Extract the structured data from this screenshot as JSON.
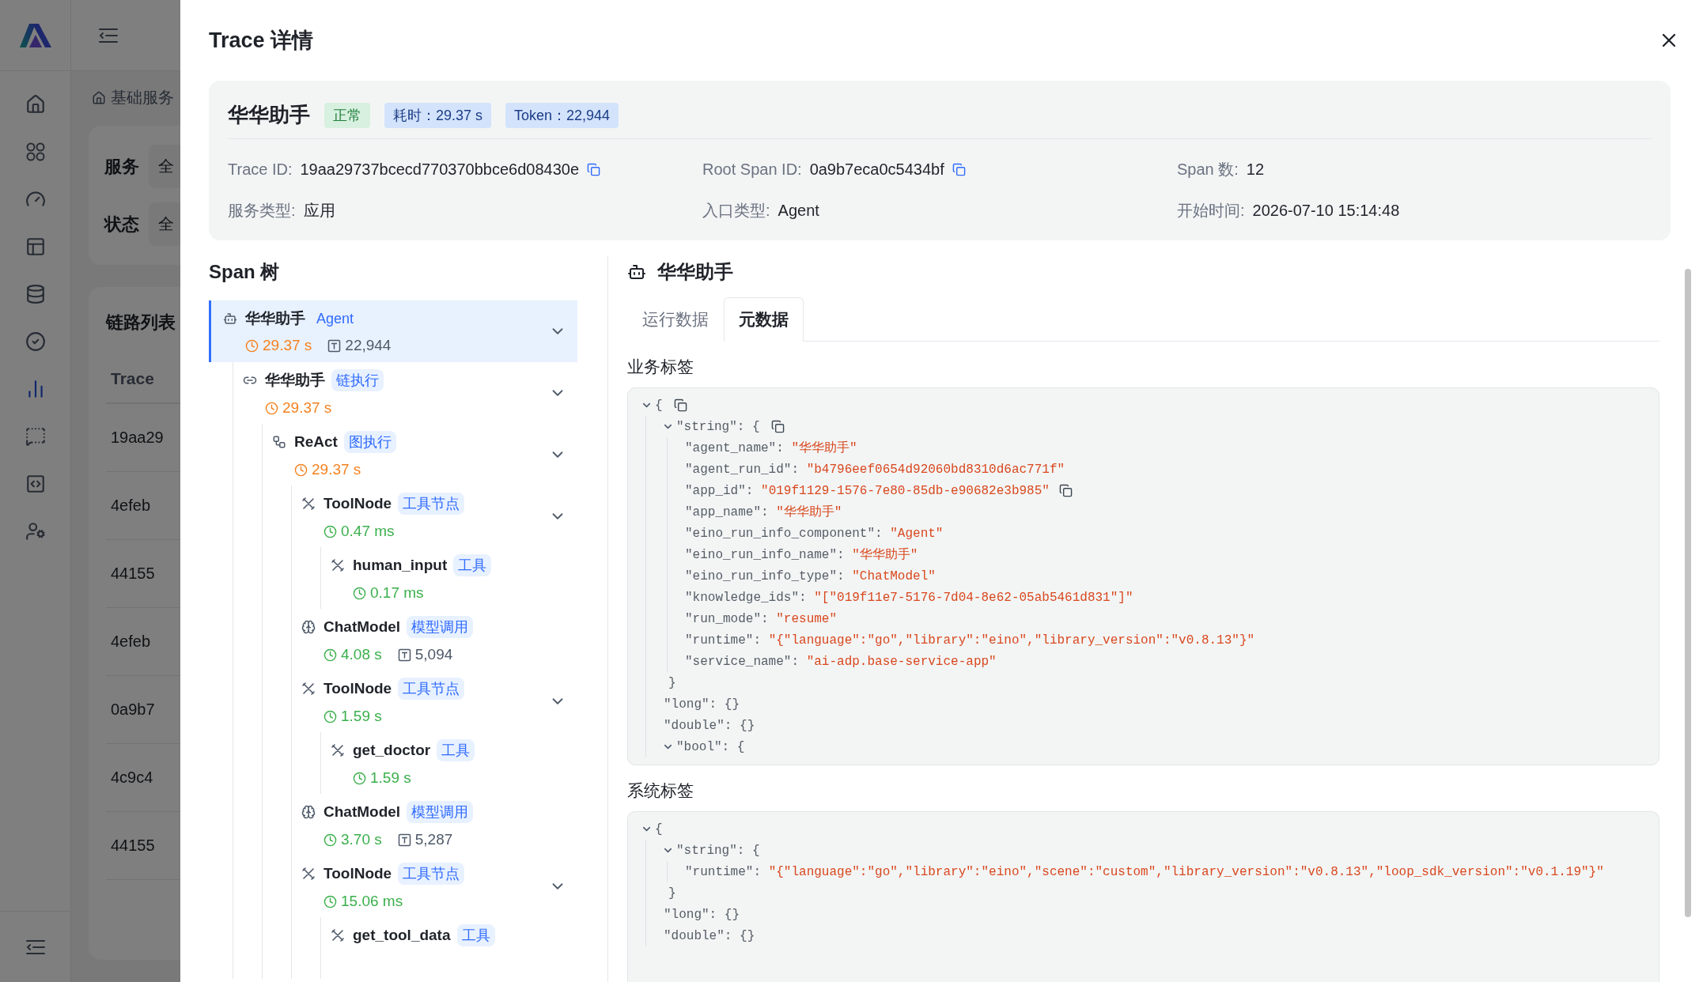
{
  "background": {
    "breadcrumb": "基础服务",
    "filters": [
      {
        "label": "服务",
        "value": "全"
      },
      {
        "label": "状态",
        "value": "全"
      }
    ],
    "list_title": "链路列表",
    "column_header": "Trace",
    "rows": [
      "19aa29",
      "4efeb",
      "44155",
      "4efeb",
      "0a9b7",
      "4c9c4",
      "44155"
    ],
    "nav_items": [
      {
        "selected": false
      },
      {
        "selected": false
      },
      {
        "selected": false
      },
      {
        "selected": false
      },
      {
        "selected": false
      },
      {
        "selected": false
      },
      {
        "selected": true
      },
      {
        "selected": false
      },
      {
        "selected": false
      },
      {
        "selected": false
      }
    ]
  },
  "drawer": {
    "title": "Trace 详情",
    "summary": {
      "name": "华华助手",
      "tags": [
        {
          "text": "正常",
          "kind": "success"
        },
        {
          "text": "耗时：29.37 s",
          "kind": "info"
        },
        {
          "text": "Token：22,944",
          "kind": "info"
        }
      ],
      "fields": [
        {
          "label": "Trace ID:",
          "value": "19aa29737bcecd770370bbce6d08430e",
          "copyable": true
        },
        {
          "label": "Root Span ID:",
          "value": "0a9b7eca0c5434bf",
          "copyable": true
        },
        {
          "label": "Span 数:",
          "value": "12"
        },
        {
          "label": "服务类型:",
          "value": "应用"
        },
        {
          "label": "入口类型:",
          "value": "Agent"
        },
        {
          "label": "开始时间:",
          "value": "2026-07-10 15:14:48"
        }
      ]
    },
    "span_tree": {
      "title": "Span 树",
      "nodes": [
        {
          "kind": "agent",
          "name": "华华助手",
          "type": "Agent",
          "duration": "29.37 s",
          "color": "#f5821f",
          "tokens": "22,944",
          "selected": true,
          "expanded": true,
          "children": [
            {
              "kind": "chain",
              "name": "华华助手",
              "type": "链执行",
              "duration": "29.37 s",
              "color": "#f5821f",
              "selected": false,
              "expanded": true,
              "children": [
                {
                  "kind": "graph",
                  "name": "ReAct",
                  "type": "图执行",
                  "duration": "29.37 s",
                  "color": "#f5821f",
                  "selected": false,
                  "expanded": true,
                  "children": [
                    {
                      "kind": "tool",
                      "name": "ToolNode",
                      "type": "工具节点",
                      "duration": "0.47 ms",
                      "color": "#3aaf4b",
                      "selected": false,
                      "expanded": true,
                      "children": [
                        {
                          "kind": "tool",
                          "name": "human_input",
                          "type": "工具",
                          "duration": "0.17 ms",
                          "color": "#3aaf4b",
                          "selected": false
                        }
                      ]
                    },
                    {
                      "kind": "model",
                      "name": "ChatModel",
                      "type": "模型调用",
                      "duration": "4.08 s",
                      "color": "#3aaf4b",
                      "tokens": "5,094",
                      "selected": false
                    },
                    {
                      "kind": "tool",
                      "name": "ToolNode",
                      "type": "工具节点",
                      "duration": "1.59 s",
                      "color": "#3aaf4b",
                      "selected": false,
                      "expanded": true,
                      "children": [
                        {
                          "kind": "tool",
                          "name": "get_doctor",
                          "type": "工具",
                          "duration": "1.59 s",
                          "color": "#3aaf4b",
                          "selected": false
                        }
                      ]
                    },
                    {
                      "kind": "model",
                      "name": "ChatModel",
                      "type": "模型调用",
                      "duration": "3.70 s",
                      "color": "#3aaf4b",
                      "tokens": "5,287",
                      "selected": false
                    },
                    {
                      "kind": "tool",
                      "name": "ToolNode",
                      "type": "工具节点",
                      "duration": "15.06 ms",
                      "color": "#3aaf4b",
                      "selected": false,
                      "expanded": true,
                      "children": [
                        {
                          "kind": "tool",
                          "name": "get_tool_data",
                          "type": "工具",
                          "selected": false
                        }
                      ]
                    }
                  ]
                }
              ]
            }
          ]
        }
      ]
    },
    "detail": {
      "title": "华华助手",
      "tabs": [
        {
          "label": "运行数据",
          "selected": false
        },
        {
          "label": "元数据",
          "selected": true
        }
      ],
      "sections": [
        {
          "title": "业务标签",
          "root": {
            "open": "{",
            "expanded": true,
            "copyable": true,
            "children": [
              {
                "key": "\"string\":",
                "open": "{",
                "expanded": true,
                "copyable": true,
                "close": "}",
                "children": [
                  {
                    "key": "\"agent_name\":",
                    "value": "\"华华助手\"",
                    "kind": "string"
                  },
                  {
                    "key": "\"agent_run_id\":",
                    "value": "\"b4796eef0654d92060bd8310d6ac771f\"",
                    "kind": "string"
                  },
                  {
                    "key": "\"app_id\":",
                    "value": "\"019f1129-1576-7e80-85db-e90682e3b985\"",
                    "kind": "string",
                    "copyable": true
                  },
                  {
                    "key": "\"app_name\":",
                    "value": "\"华华助手\"",
                    "kind": "string"
                  },
                  {
                    "key": "\"eino_run_info_component\":",
                    "value": "\"Agent\"",
                    "kind": "string"
                  },
                  {
                    "key": "\"eino_run_info_name\":",
                    "value": "\"华华助手\"",
                    "kind": "string"
                  },
                  {
                    "key": "\"eino_run_info_type\":",
                    "value": "\"ChatModel\"",
                    "kind": "string"
                  },
                  {
                    "key": "\"knowledge_ids\":",
                    "value": "\"[\"019f11e7-5176-7d04-8e62-05ab5461d831\"]\"",
                    "kind": "string"
                  },
                  {
                    "key": "\"run_mode\":",
                    "value": "\"resume\"",
                    "kind": "string"
                  },
                  {
                    "key": "\"runtime\":",
                    "value": "\"{\"language\":\"go\",\"library\":\"eino\",\"library_version\":\"v0.8.13\"}\"",
                    "kind": "string"
                  },
                  {
                    "key": "\"service_name\":",
                    "value": "\"ai-adp.base-service-app\"",
                    "kind": "string"
                  }
                ]
              },
              {
                "key": "\"long\":",
                "value": "{}",
                "kind": "empty"
              },
              {
                "key": "\"double\":",
                "value": "{}",
                "kind": "empty"
              },
              {
                "key": "\"bool\":",
                "open": "{",
                "expanded": true,
                "copyable": false
              }
            ]
          }
        },
        {
          "title": "系统标签",
          "root": {
            "open": "{",
            "expanded": true,
            "children": [
              {
                "key": "\"string\":",
                "open": "{",
                "expanded": true,
                "close": "}",
                "children": [
                  {
                    "key": "\"runtime\":",
                    "value": "\"{\"language\":\"go\",\"library\":\"eino\",\"scene\":\"custom\",\"library_version\":\"v0.8.13\",\"loop_sdk_version\":\"v0.1.19\"}\"",
                    "kind": "string"
                  }
                ]
              },
              {
                "key": "\"long\":",
                "value": "{}",
                "kind": "empty"
              },
              {
                "key": "\"double\":",
                "value": "{}",
                "kind": "empty"
              }
            ]
          }
        }
      ]
    }
  }
}
